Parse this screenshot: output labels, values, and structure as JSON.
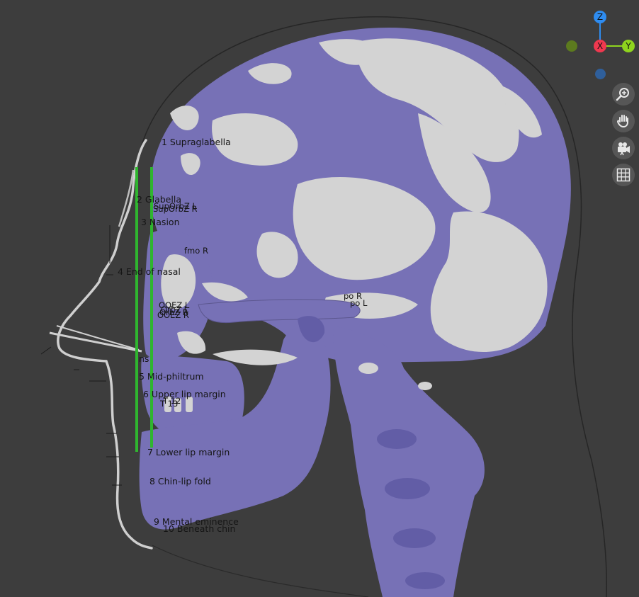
{
  "viewport": {
    "background": "#3d3d3d",
    "skull_color": "#7771b6",
    "bone_light_color": "#d3d3d3",
    "marker_color": "#2fb52f"
  },
  "landmarks": [
    {
      "id": "supraglabella",
      "label": "1 Supraglabella"
    },
    {
      "id": "glabella",
      "label": "2 Glabella"
    },
    {
      "id": "suporbz-l",
      "label": "SupOrbZ L"
    },
    {
      "id": "suporbz-r",
      "label": "SupOrbZ R"
    },
    {
      "id": "nasion",
      "label": "3 Nasion"
    },
    {
      "id": "fmo-r",
      "label": "fmo R"
    },
    {
      "id": "end-of-nasal",
      "label": "4 End of nasal"
    },
    {
      "id": "orbital-cluster-1",
      "label": "OOEZ L"
    },
    {
      "id": "orbital-cluster-2",
      "label": "OrbZ L"
    },
    {
      "id": "orbital-cluster-3",
      "label": "OrbZ R"
    },
    {
      "id": "orbital-cluster-4",
      "label": "OOEZ R"
    },
    {
      "id": "po-r",
      "label": "po R"
    },
    {
      "id": "po-l",
      "label": "po L"
    },
    {
      "id": "ns",
      "label": "ns"
    },
    {
      "id": "mid-philtrum",
      "label": "5 Mid-philtrum"
    },
    {
      "id": "upper-lip-margin",
      "label": "6 Upper lip margin"
    },
    {
      "id": "t-12",
      "label": "T 12"
    },
    {
      "id": "t-13",
      "label": "T 13"
    },
    {
      "id": "lower-lip-margin",
      "label": "7 Lower lip margin"
    },
    {
      "id": "chin-lip-fold",
      "label": "8 Chin-lip fold"
    },
    {
      "id": "mental-eminence",
      "label": "9 Mental eminence"
    },
    {
      "id": "beneath-chin",
      "label": "10 Beneath chin"
    }
  ],
  "gizmo": {
    "axes": [
      {
        "id": "z",
        "label": "Z",
        "color": "#2e8cf0"
      },
      {
        "id": "x",
        "label": "X",
        "color": "#f0384f"
      },
      {
        "id": "y",
        "label": "Y",
        "color": "#8fd41e"
      },
      {
        "id": "neg-y",
        "label": "",
        "color": "#5c7a1e"
      },
      {
        "id": "neg-z",
        "label": "",
        "color": "#2f5f9b"
      }
    ]
  },
  "toolbar": [
    {
      "id": "zoom",
      "icon": "zoom-icon",
      "tooltip": ""
    },
    {
      "id": "pan",
      "icon": "hand-icon",
      "tooltip": ""
    },
    {
      "id": "camera",
      "icon": "camera-icon",
      "tooltip": ""
    },
    {
      "id": "grid",
      "icon": "grid-icon",
      "tooltip": ""
    }
  ]
}
